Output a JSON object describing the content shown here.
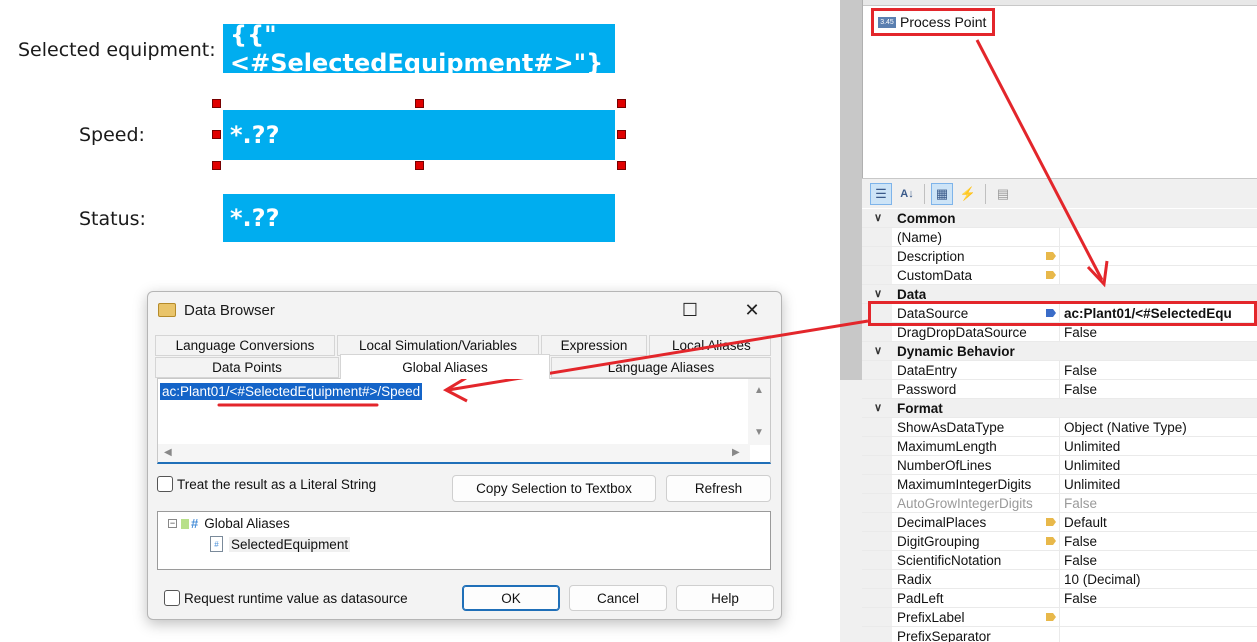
{
  "canvas": {
    "selected_equipment_label": "Selected equipment:",
    "selected_equipment_value": "{{\"<#SelectedEquipment#>\"}",
    "speed_label": "Speed:",
    "speed_value": "*.??",
    "status_label": "Status:",
    "status_value": "*.??"
  },
  "toolbox": {
    "process_point": "Process Point",
    "process_point_icon_text": "3.45"
  },
  "properties": {
    "toolbar_icons": [
      "categorized-icon",
      "alphabetical-icon",
      "properties-icon",
      "events-icon",
      "property-pages-icon"
    ],
    "rows": [
      {
        "type": "category",
        "name": "Common"
      },
      {
        "name": "(Name)",
        "value": ""
      },
      {
        "name": "Description",
        "value": "",
        "tag": "yellow"
      },
      {
        "name": "CustomData",
        "value": "",
        "tag": "yellow"
      },
      {
        "type": "category",
        "name": "Data"
      },
      {
        "name": "DataSource",
        "value": "ac:Plant01/<#SelectedEqu",
        "tag": "blue",
        "bold_value": true
      },
      {
        "name": "DragDropDataSource",
        "value": "False"
      },
      {
        "type": "category",
        "name": "Dynamic Behavior"
      },
      {
        "name": "DataEntry",
        "value": "False"
      },
      {
        "name": "Password",
        "value": "False"
      },
      {
        "type": "category",
        "name": "Format"
      },
      {
        "name": "ShowAsDataType",
        "value": "Object (Native Type)"
      },
      {
        "name": "MaximumLength",
        "value": "Unlimited"
      },
      {
        "name": "NumberOfLines",
        "value": "Unlimited"
      },
      {
        "name": "MaximumIntegerDigits",
        "value": "Unlimited"
      },
      {
        "name": "AutoGrowIntegerDigits",
        "value": "False",
        "disabled": true
      },
      {
        "name": "DecimalPlaces",
        "value": "Default",
        "tag": "yellow"
      },
      {
        "name": "DigitGrouping",
        "value": "False",
        "tag": "yellow"
      },
      {
        "name": "ScientificNotation",
        "value": "False"
      },
      {
        "name": "Radix",
        "value": "10 (Decimal)"
      },
      {
        "name": "PadLeft",
        "value": "False"
      },
      {
        "name": "PrefixLabel",
        "value": "",
        "tag": "yellow"
      },
      {
        "name": "PrefixSeparator",
        "value": ""
      }
    ]
  },
  "dialog": {
    "title": "Data Browser",
    "tabs_row1": [
      "Language Conversions",
      "Local Simulation/Variables",
      "Expression",
      "Local Aliases"
    ],
    "tabs_row2": [
      "Data Points",
      "Global Aliases",
      "Language Aliases"
    ],
    "expression": "ac:Plant01/<#SelectedEquipment#>/Speed",
    "literal_checkbox": "Treat the result as a Literal String",
    "copy_button": "Copy Selection to Textbox",
    "refresh_button": "Refresh",
    "tree_root": "Global Aliases",
    "tree_child": "SelectedEquipment",
    "runtime_checkbox": "Request runtime value as datasource",
    "ok_button": "OK",
    "cancel_button": "Cancel",
    "help_button": "Help"
  },
  "colors": {
    "field_blue": "#00adef",
    "annotation_red": "#e3262b",
    "selection_blue": "#1464c8"
  }
}
